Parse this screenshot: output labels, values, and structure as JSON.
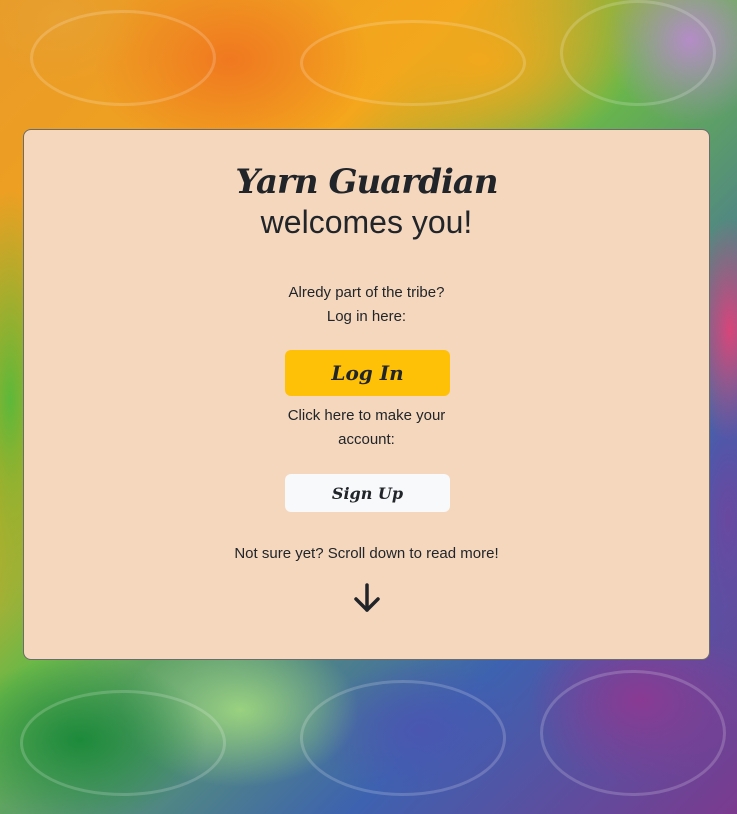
{
  "card": {
    "brand": "Yarn Guardian",
    "welcome": "welcomes you!",
    "login_prompt_line1": "Alredy part of the tribe?",
    "login_prompt_line2": "Log in here:",
    "login_button": "Log In",
    "signup_prompt_line1": "Click here to make your",
    "signup_prompt_line2": "account:",
    "signup_button": "Sign Up",
    "scroll_hint": "Not sure yet? Scroll down to read more!",
    "scroll_icon": "arrow-down-icon"
  },
  "colors": {
    "card_background": "#f5d7be",
    "login_button": "#ffc107",
    "signup_button": "#f8f9fa",
    "text": "#212529"
  }
}
